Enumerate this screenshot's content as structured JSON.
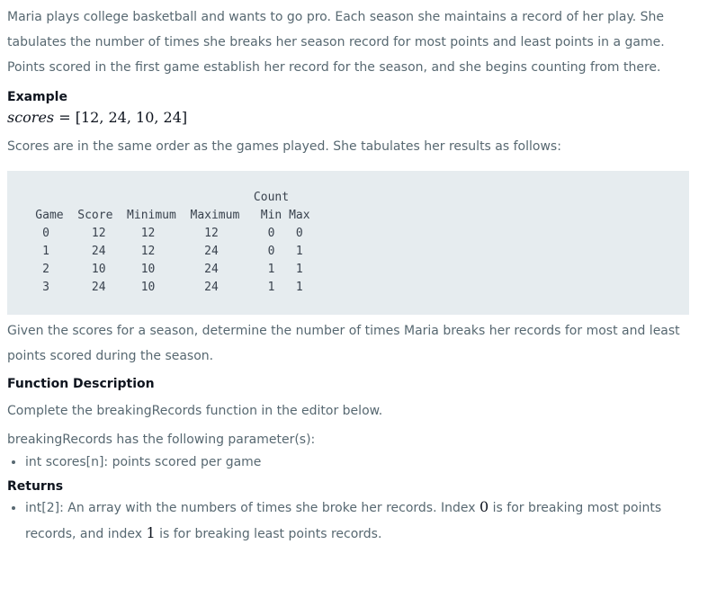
{
  "intro": "Maria plays college basketball and wants to go pro. Each season she maintains a record of her play. She tabulates the number of times she breaks her season record for most points and least points in a game. Points scored in the first game establish her record for the season, and she begins counting from there.",
  "example_heading": "Example",
  "example_math": {
    "var": "scores",
    "eq": " = ",
    "value": "[12, 24, 10, 24]"
  },
  "after_example": "Scores are in the same order as the games played. She tabulates her results as follows:",
  "table": {
    "header1": "                                   Count",
    "header2": "    Game  Score  Minimum  Maximum   Min Max",
    "rows": [
      "     0      12     12       12       0   0",
      "     1      24     12       24       0   1",
      "     2      10     10       24       1   1",
      "     3      24     10       24       1   1"
    ]
  },
  "task": "Given the scores for a season, determine the number of times Maria breaks her records for most and least points scored during the season.",
  "function_desc_heading": "Function Description",
  "function_desc_text": "Complete the breakingRecords function in the editor below.",
  "params_text": "breakingRecords has the following parameter(s):",
  "params": [
    "int scores[n]: points scored per game"
  ],
  "returns_heading": "Returns",
  "returns": {
    "part1": "int[2]: An array with the numbers of times she broke her records. Index ",
    "idx0": "0",
    "part2": " is for breaking most points records, and index ",
    "idx1": "1",
    "part3": " is for breaking least points records."
  }
}
